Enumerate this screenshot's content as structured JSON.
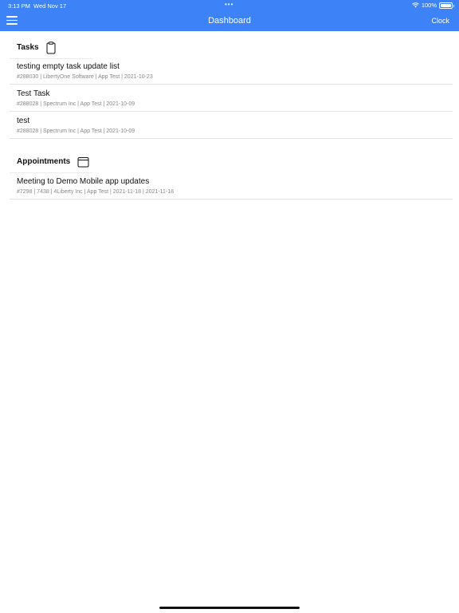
{
  "status_bar": {
    "time": "3:13 PM",
    "date": "Wed Nov 17",
    "battery": "100%",
    "battery_level": 1.0
  },
  "nav": {
    "title": "Dashboard",
    "right_button": "Clock"
  },
  "colors": {
    "accent": "#3e82f7"
  },
  "tasks": {
    "title": "Tasks",
    "icon": "clipboard-icon",
    "items": [
      {
        "title": "testing empty task update list",
        "subtitle": "#288030 | LibertyOne Software | App Test | 2021-10-23"
      },
      {
        "title": "Test Task",
        "subtitle": "#288028 | Spectrum Inc | App Test | 2021-10-09"
      },
      {
        "title": "test",
        "subtitle": "#288028 | Spectrum Inc | App Test | 2021-10-09"
      }
    ]
  },
  "appointments": {
    "title": "Appointments",
    "icon": "calendar-icon",
    "items": [
      {
        "title": "Meeting to Demo Mobile app updates",
        "subtitle": "#7298 | 7438 | 4Liberty Inc | App Test | 2021-11-18 | 2021-11-18"
      }
    ]
  }
}
